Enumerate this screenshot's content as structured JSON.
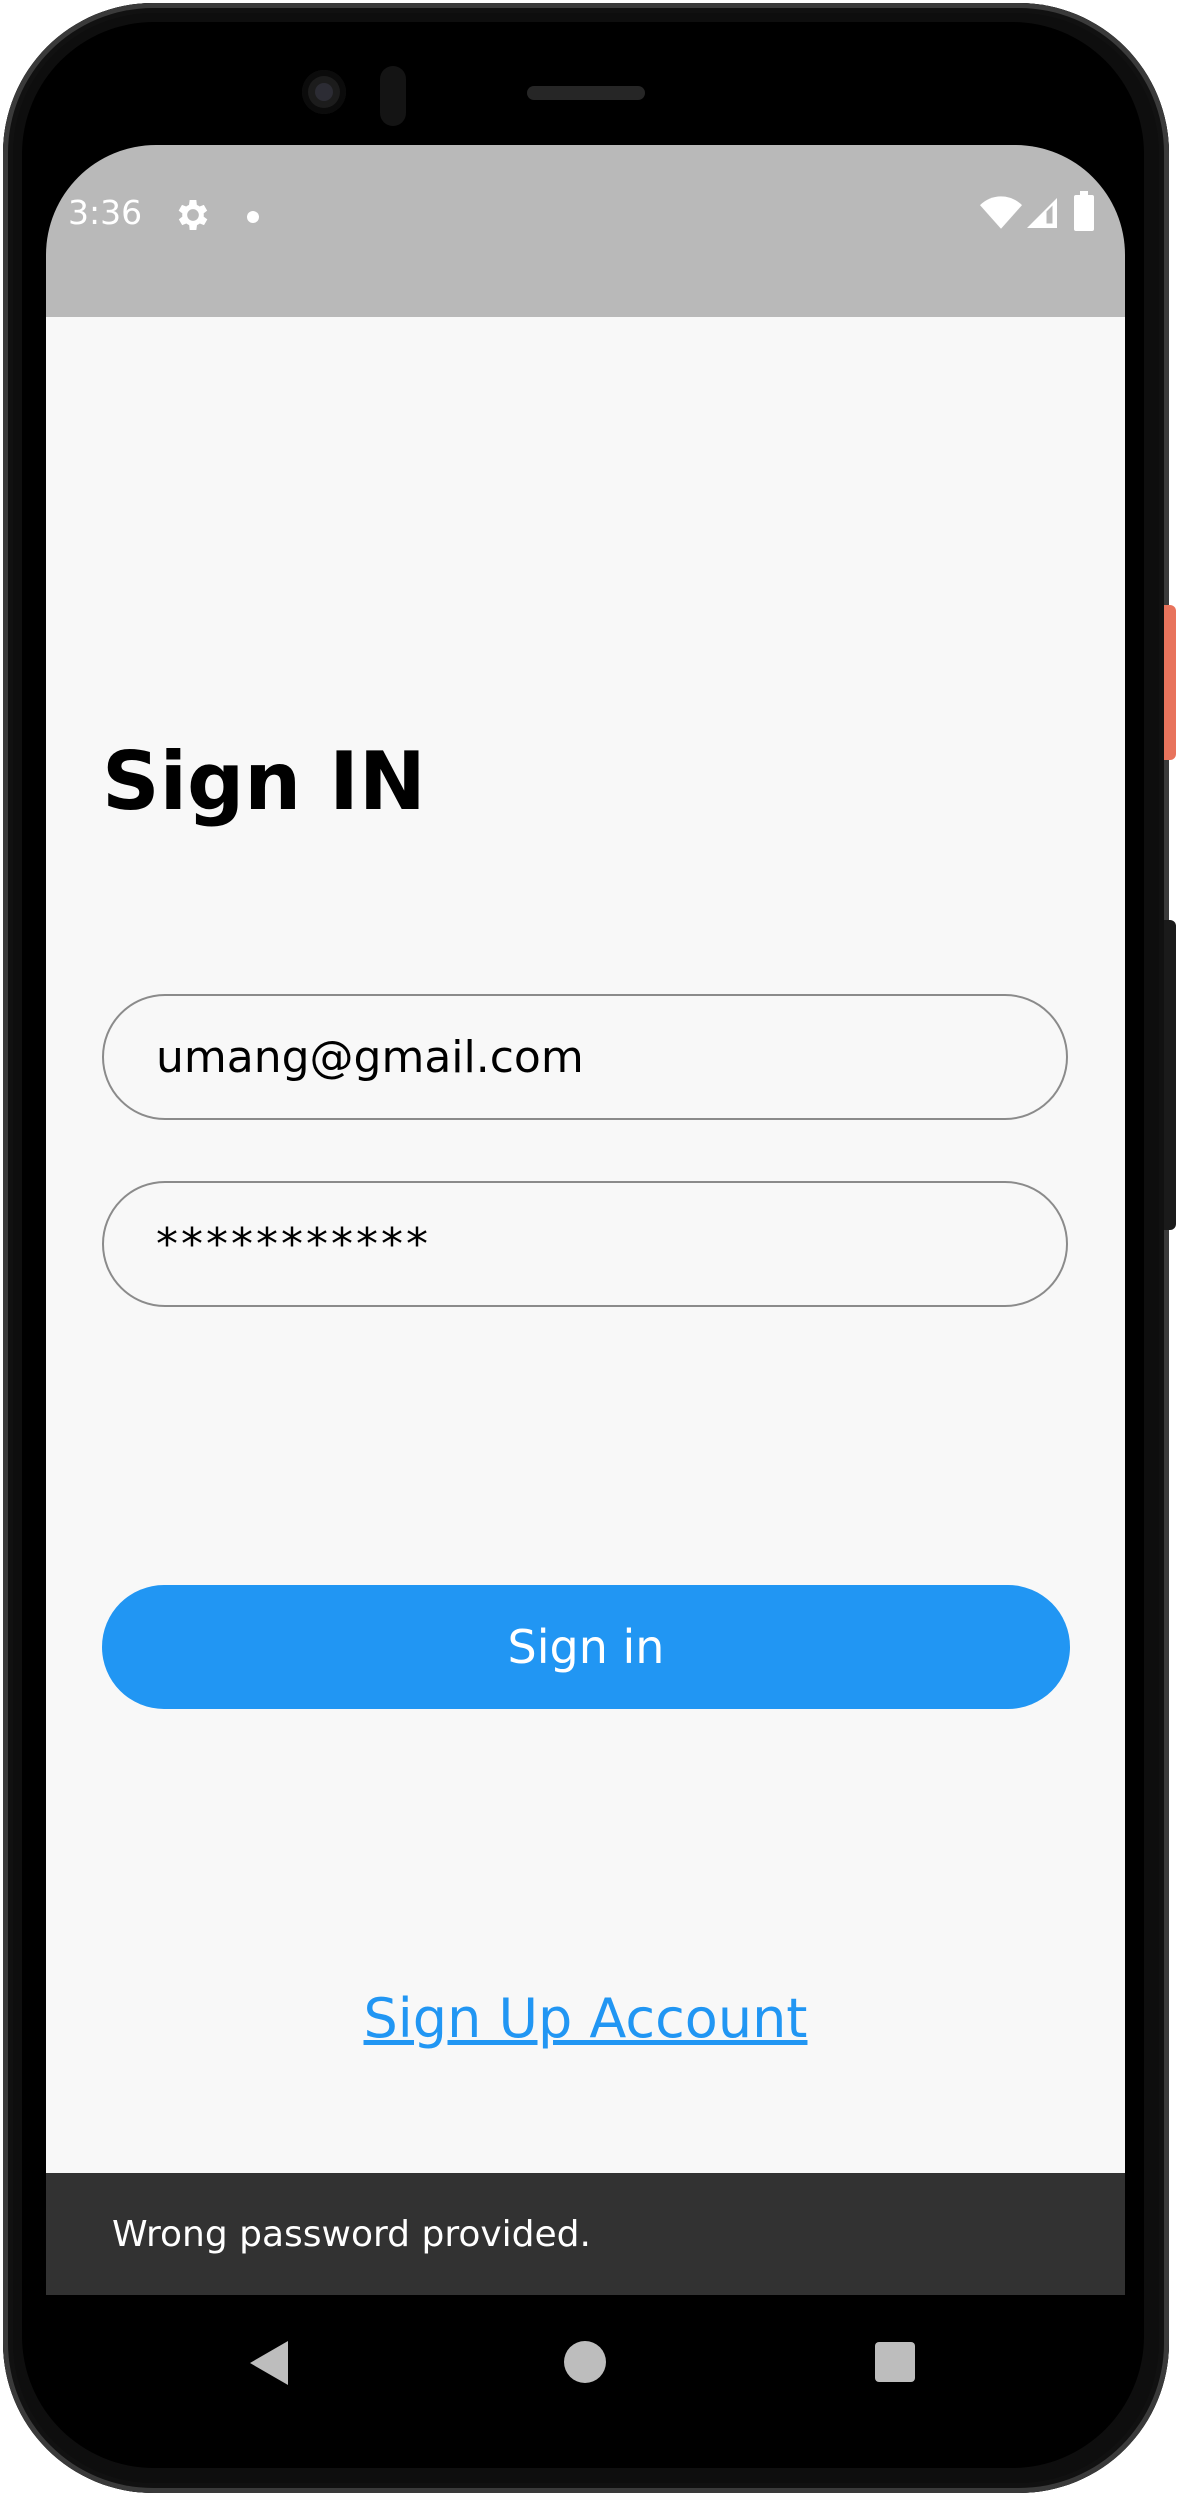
{
  "status_bar": {
    "time": "3:36",
    "icons": [
      "gear-icon",
      "notification-dot-icon",
      "wifi-icon",
      "signal-icon",
      "battery-icon"
    ]
  },
  "sign_in": {
    "title": "Sign IN",
    "email_value": "umang@gmail.com",
    "password_value": "***********",
    "button_label": "Sign in",
    "signup_link": "Sign Up Account"
  },
  "snackbar": {
    "message": "Wrong password provided."
  },
  "nav_bar": {
    "icons": [
      "back-icon",
      "home-icon",
      "recents-icon"
    ]
  },
  "colors": {
    "accent": "#2196f3",
    "background": "#f8f8f8",
    "status_bar": "#b9b9b9",
    "snackbar": "#323232"
  }
}
